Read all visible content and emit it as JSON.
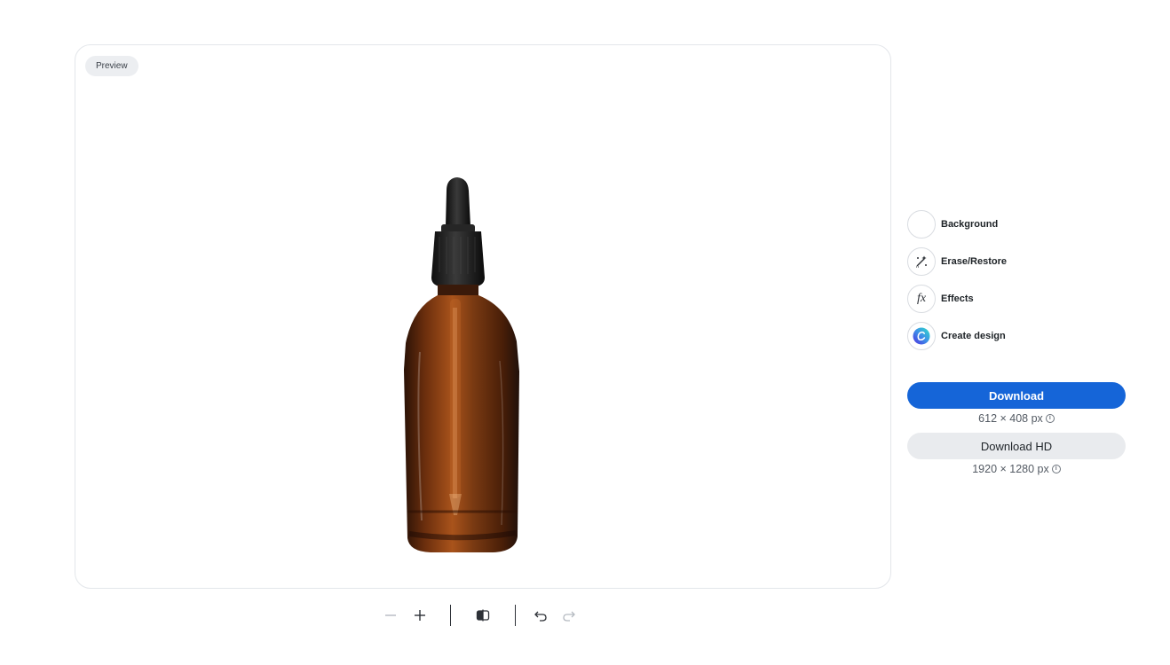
{
  "preview": {
    "badge": "Preview",
    "image_subject": "amber dropper bottle with black dropper cap"
  },
  "toolbar": {
    "zoom_out_icon": "minus-icon",
    "zoom_in_icon": "plus-icon",
    "compare_icon": "compare-split-icon",
    "undo_icon": "undo-icon",
    "redo_icon": "redo-icon"
  },
  "side_panel": {
    "items": [
      {
        "label": "Background",
        "icon": "empty-circle"
      },
      {
        "label": "Erase/Restore",
        "icon": "magic-wand-icon"
      },
      {
        "label": "Effects",
        "icon": "fx-icon"
      },
      {
        "label": "Create design",
        "icon": "canva-logo-icon"
      }
    ],
    "effects_glyph": "fx"
  },
  "download": {
    "label": "Download",
    "size": "612 × 408 px",
    "hd_label": "Download HD",
    "hd_size": "1920 × 1280 px",
    "info_glyph": "i"
  },
  "colors": {
    "accent": "#1565d8",
    "secondary_button": "#e9ebee",
    "badge_bg": "#eceef1",
    "bottle_amber": "#7a3a12",
    "cap_black": "#1c1c1c"
  }
}
